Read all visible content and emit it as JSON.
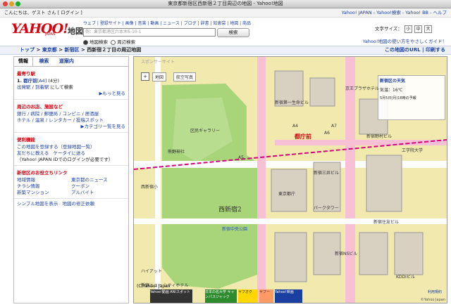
{
  "window": {
    "title": "東京都新宿区西新宿２丁目周辺の地図 - Yahoo!地図"
  },
  "topbar": {
    "greeting": "こんにちは、ゲスト さん [ ログイン ]",
    "right_links": "Yahoo! JAPAN - Yahoo!検索 - Yahoo! BB - ヘルプ"
  },
  "header": {
    "logo": "YAHOO!",
    "logo_sub": "JAPAN",
    "service": "地図",
    "nav": "ウェブ | 登録サイト | 画像 | 音楽 | 動画 | ニュース | ブログ | 辞書 | 知恵袋 | 地図 | 商品",
    "search_placeholder": "例：東京都港区六本木6-10-1",
    "search_button": "検索",
    "radio_map": "地図検索",
    "radio_near": "周辺検索",
    "font_size_label": "文字サイズ：",
    "font_buttons": [
      "小",
      "中",
      "大"
    ],
    "guide_link": "Yahoo!地図の使い方をやさしくガイド！"
  },
  "breadcrumb": {
    "items": [
      "トップ",
      "東京都",
      "新宿区",
      "西新宿２丁目の周辺地図"
    ],
    "seps": [
      ">",
      ">",
      ">"
    ],
    "url_link": "この地図のURL",
    "print_link": "印刷する"
  },
  "sidebar": {
    "tabs": [
      "情報",
      "検索",
      "道案内"
    ],
    "nearest_title": "最寄り駅",
    "station_num": "1.",
    "station_name": "都庁前",
    "station_exit": "[A4]",
    "station_time": "(4分)",
    "depart_link": "出発駅",
    "arrive_link": "到着駅",
    "search_suffix": "にして検索",
    "more1": "▶もっと見る",
    "nearby_title": "周辺のお店、施設など",
    "nearby_lines": [
      "銀行 / 病院 / 郵便局 / コンビニ / 居酒屋",
      "ホテル / 温泉 / レンタカー / 投稿スポット"
    ],
    "category_link": "▶カテゴリ一覧を見る",
    "tools_title": "便利機能",
    "register_link": "この地図を登録する",
    "register_list": "（登録地図一覧）",
    "tell_friend": "友だちに教える",
    "send_mobile": "ケータイに送る",
    "login_note": "（Yahoo! JAPAN IDでのログインが必要です）",
    "local_title": "新宿区のお役立ちリンク",
    "local_links": [
      "地域情報",
      "東京都のニュース",
      "チラシ情報",
      "クーポン",
      "新築マンション",
      "アルバイト"
    ],
    "simple_map": "シンプル地図を表示",
    "fix_map": "地図の修正依頼"
  },
  "map": {
    "sponsor_label": "スポンサーサイト",
    "btn_map": "地図",
    "btn_photo": "航空写真",
    "weather_title": "新宿区の天気",
    "weather_temp": "気温：16℃",
    "weather_time": "5月5日(月)18時の予報",
    "labels": {
      "tocho_station": "都庁前",
      "shinjuku_park": "新宿中央公園",
      "nishi_shinjuku": "西新宿2",
      "tokyo_tocho": "東京都庁",
      "gallery": "区民ギャラリー",
      "kumano": "熊野神社",
      "a5": "A5",
      "a6": "A6",
      "a4": "A4",
      "a7": "A7",
      "kogakuin": "工学院大学",
      "nomura": "新宿野村ビル",
      "mitsui": "新宿三井ビル",
      "keio_plaza": "京王プラザホテル",
      "nscenter": "新宿NSビル",
      "kddi": "KDDIビル",
      "mitsui_sumitomo": "新宿住友ビル",
      "shinjuku_first": "新宿第一生命ビル",
      "park_tower": "パークタワー",
      "hyatt": "ハイアット",
      "oak": "新宿ニュー シティホテル",
      "elementary": "西新宿小"
    },
    "copyright": "(C)Yahoo! Japan",
    "yj": "©Yahoo Japan",
    "scale": "利用規約",
    "ads": [
      "Yahoo!動画 ANIスポット",
      "日本の名大学 キャンパスジャック",
      "ヤフオク",
      "ヤフー",
      "Yahoo!映画"
    ]
  },
  "colors": {
    "brand_red": "#d6000f",
    "link_blue": "#1a3fa0",
    "park_green": "#a8d47a",
    "road_pink": "#f2a6c4",
    "map_base": "#f2e9ae",
    "building": "#d8d0c0"
  }
}
